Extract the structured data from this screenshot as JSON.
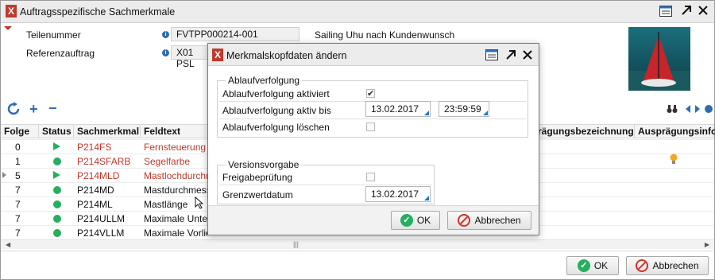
{
  "window": {
    "title": "Auftragsspezifische Sachmerkmale",
    "teilenummer_label": "Teilenummer",
    "teilenummer_value": "FVTPP000214-001",
    "teilenummer_desc": "Sailing Uhu nach Kundenwunsch",
    "referenz_label": "Referenzauftrag",
    "referenz_value": "X01 PSL"
  },
  "toolbar": {
    "refresh_icon": "refresh-icon",
    "add_icon": "plus-icon",
    "remove_icon": "minus-icon"
  },
  "grid": {
    "headers": {
      "folge": "Folge",
      "status": "Status",
      "sachmerkmal": "Sachmerkmal",
      "feldtext": "Feldtext",
      "auspraegungsbezeichnung": "rägungsbezeichnung",
      "auspraegungsinfo": "Ausprägungsinfo"
    },
    "rows": [
      {
        "folge": "0",
        "status": "triangle",
        "sachmerkmal": "P214FS",
        "feldtext": "Fernsteuerung",
        "red": true
      },
      {
        "folge": "1",
        "status": "dot",
        "sachmerkmal": "P214SFARB",
        "feldtext": "Segelfarbe",
        "red": true
      },
      {
        "folge": "5",
        "status": "triangle",
        "sachmerkmal": "P214MLD",
        "feldtext": "Mastlochdurchm",
        "red": true
      },
      {
        "folge": "7",
        "status": "dot",
        "sachmerkmal": "P214MD",
        "feldtext": "Mastdurchmess",
        "red": false
      },
      {
        "folge": "7",
        "status": "dot",
        "sachmerkmal": "P214ML",
        "feldtext": "Mastlänge",
        "red": false
      },
      {
        "folge": "7",
        "status": "dot",
        "sachmerkmal": "P214ULLM",
        "feldtext": "Maximale Unterl",
        "red": false
      },
      {
        "folge": "7",
        "status": "dot",
        "sachmerkmal": "P214VLLM",
        "feldtext": "Maximale Vorlie",
        "red": false
      }
    ],
    "scroll_grip": "|||"
  },
  "footer": {
    "ok_label": "OK",
    "cancel_label": "Abbrechen"
  },
  "dialog": {
    "title": "Merkmalskopfdaten ändern",
    "group1_legend": "Ablaufverfolgung",
    "aktiviert_label": "Ablaufverfolgung aktiviert",
    "aktiviert_checked": true,
    "aktiv_bis_label": "Ablaufverfolgung aktiv bis",
    "aktiv_bis_date": "13.02.2017",
    "aktiv_bis_time": "23:59:59",
    "loeschen_label": "Ablaufverfolgung löschen",
    "loeschen_checked": false,
    "group2_legend": "Versionsvorgabe",
    "freigabe_label": "Freigabeprüfung",
    "freigabe_checked": false,
    "grenzwert_label": "Grenzwertdatum",
    "grenzwert_date": "13.02.2017",
    "ok_label": "OK",
    "cancel_label": "Abbrechen"
  }
}
